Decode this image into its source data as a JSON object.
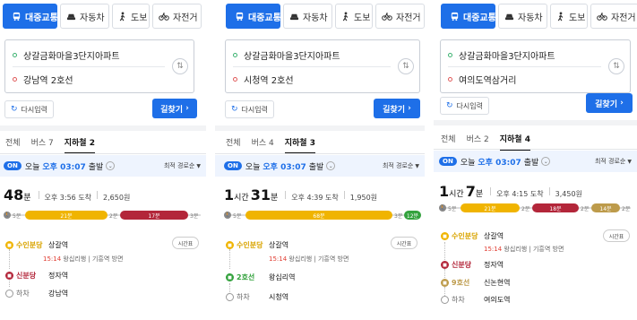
{
  "modes": [
    "대중교통",
    "자동차",
    "도보",
    "자전거"
  ],
  "reset_label": "다시입력",
  "search_label": "길찾기",
  "sort_label": "최적 경로순",
  "on_label": "ON",
  "timetable_label": "시간표",
  "colors": {
    "accent": "#1e6fe8",
    "suin_bundang": "#f0b400",
    "sinbundang": "#b3263a",
    "line2": "#33a23d",
    "line9": "#bd9b4b",
    "walk": "#888888"
  },
  "panels": [
    {
      "origin": "상갈금화마을3단지아파트",
      "destination": "강남역 2호선",
      "tabs": [
        "전체",
        "버스 7",
        "지하철 2"
      ],
      "departure": {
        "prefix": "오늘",
        "time": "오후 03:07",
        "suffix": "출발"
      },
      "summary": {
        "h": "",
        "h_unit": "",
        "m": "48",
        "m_unit": "분",
        "arrival": "오후 3:56 도착",
        "fare": "2,650원"
      },
      "bar": {
        "walk_start": "5분",
        "seg1": "21분",
        "walk_mid": "2분",
        "seg2": "17분",
        "walk_end": "3분"
      },
      "steps": [
        {
          "line": "수인분당",
          "station": "상갈역",
          "sub_time": "15:14",
          "sub_rest": "왕십리행 | 기흥역 방면"
        },
        {
          "line": "신분당",
          "station": "정자역"
        },
        {
          "line": "하차",
          "station": "강남역"
        }
      ]
    },
    {
      "origin": "상갈금화마을3단지아파트",
      "destination": "시청역 2호선",
      "tabs": [
        "전체",
        "버스 4",
        "지하철 3"
      ],
      "departure": {
        "prefix": "오늘",
        "time": "오후 03:07",
        "suffix": "출발"
      },
      "summary": {
        "h": "1",
        "h_unit": "시간",
        "m": "31",
        "m_unit": "분",
        "arrival": "오후 4:39 도착",
        "fare": "1,950원"
      },
      "bar": {
        "walk_start": "5분",
        "seg1": "68분",
        "walk_mid": "3분",
        "seg2": "12분"
      },
      "steps": [
        {
          "line": "수인분당",
          "station": "상갈역",
          "sub_time": "15:14",
          "sub_rest": "왕십리행 | 기흥역 방면"
        },
        {
          "line": "2호선",
          "station": "왕십리역"
        },
        {
          "line": "하차",
          "station": "시청역"
        }
      ]
    },
    {
      "origin": "상갈금화마을3단지아파트",
      "destination": "여의도역삼거리",
      "tabs": [
        "전체",
        "버스 2",
        "지하철 4"
      ],
      "departure": {
        "prefix": "오늘",
        "time": "오후 03:07",
        "suffix": "출발"
      },
      "summary": {
        "h": "1",
        "h_unit": "시간",
        "m": "7",
        "m_unit": "분",
        "arrival": "오후 4:15 도착",
        "fare": "3,450원"
      },
      "bar": {
        "walk_start": "5분",
        "seg1": "21분",
        "walk_mid": "2분",
        "seg2": "18분",
        "walk_mid2": "2분",
        "seg3": "14분",
        "walk_end": "2분"
      },
      "steps": [
        {
          "line": "수인분당",
          "station": "상갈역",
          "sub_time": "15:14",
          "sub_rest": "왕십리행 | 기흥역 방면"
        },
        {
          "line": "신분당",
          "station": "정자역"
        },
        {
          "line": "9호선",
          "station": "신논현역"
        },
        {
          "line": "하차",
          "station": "여의도역"
        }
      ]
    }
  ]
}
